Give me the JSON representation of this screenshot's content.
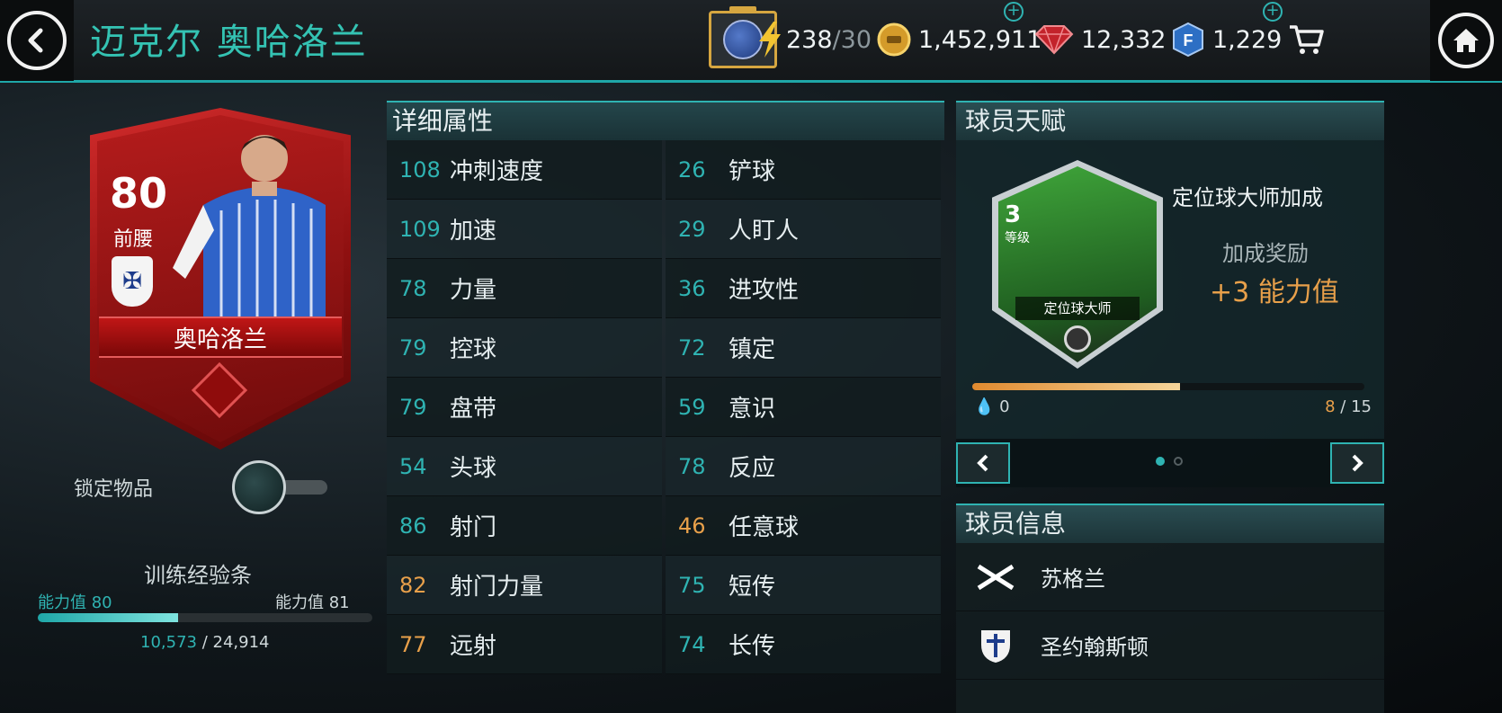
{
  "header": {
    "player_name": "迈克尔 奥哈洛兰",
    "energy_current": "238",
    "energy_max": "/30",
    "coins": "1,452,911",
    "gems": "12,332",
    "points": "1,229"
  },
  "card": {
    "rating": "80",
    "position": "前腰",
    "short_name": "奥哈洛兰"
  },
  "left": {
    "lock_label": "锁定物品",
    "training_title": "训练经验条",
    "ability_current": "能力值 80",
    "ability_next": "能力值 81",
    "xp_current": "10,573",
    "xp_total": " / 24,914",
    "xp_fraction": 0.42
  },
  "attributes": {
    "title": "详细属性",
    "rows": [
      [
        {
          "value": "108",
          "name": "冲刺速度",
          "highlight": false
        },
        {
          "value": "26",
          "name": "铲球",
          "highlight": false
        }
      ],
      [
        {
          "value": "109",
          "name": "加速",
          "highlight": false
        },
        {
          "value": "29",
          "name": "人盯人",
          "highlight": false
        }
      ],
      [
        {
          "value": "78",
          "name": "力量",
          "highlight": false
        },
        {
          "value": "36",
          "name": "进攻性",
          "highlight": false
        }
      ],
      [
        {
          "value": "79",
          "name": "控球",
          "highlight": false
        },
        {
          "value": "72",
          "name": "镇定",
          "highlight": false
        }
      ],
      [
        {
          "value": "79",
          "name": "盘带",
          "highlight": false
        },
        {
          "value": "59",
          "name": "意识",
          "highlight": false
        }
      ],
      [
        {
          "value": "54",
          "name": "头球",
          "highlight": false
        },
        {
          "value": "78",
          "name": "反应",
          "highlight": false
        }
      ],
      [
        {
          "value": "86",
          "name": "射门",
          "highlight": false
        },
        {
          "value": "46",
          "name": "任意球",
          "highlight": true
        }
      ],
      [
        {
          "value": "82",
          "name": "射门力量",
          "highlight": true
        },
        {
          "value": "75",
          "name": "短传",
          "highlight": false
        }
      ],
      [
        {
          "value": "77",
          "name": "远射",
          "highlight": true
        },
        {
          "value": "74",
          "name": "长传",
          "highlight": false
        }
      ]
    ]
  },
  "talent": {
    "title": "球员天赋",
    "level": "3",
    "level_label": "等级",
    "badge_name": "定位球大师",
    "name": "定位球大师加成",
    "bonus_label": "加成奖励",
    "bonus_value": "+3 能力值",
    "progress_min": "0",
    "progress_current": "8",
    "progress_total": " / 15",
    "progress_fraction": 0.53
  },
  "info": {
    "title": "球员信息",
    "nation": "苏格兰",
    "club": "圣约翰斯顿"
  },
  "colors": {
    "accent": "#2fb3b2",
    "highlight": "#e8a04a",
    "card_red": "#b51c1c"
  }
}
